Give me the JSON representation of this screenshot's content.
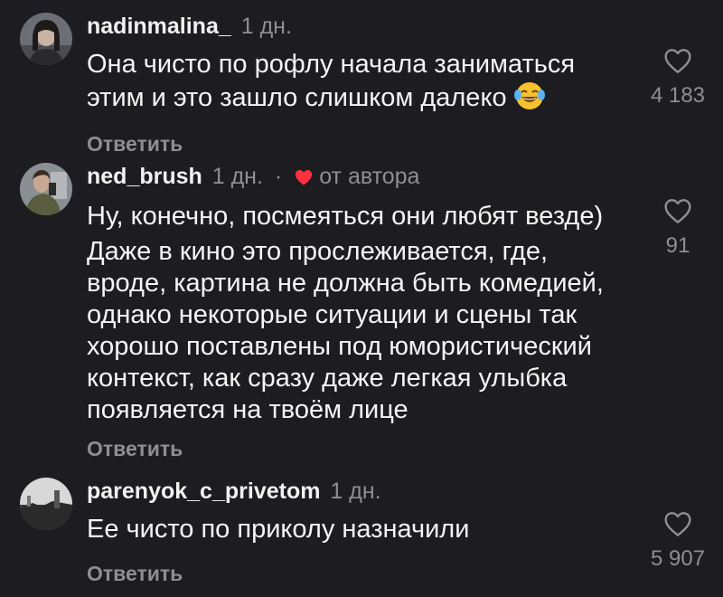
{
  "comments": [
    {
      "username": "nadinmalina_",
      "time": "1 дн.",
      "lines": [
        "Она чисто по рофлу начала заниматься",
        "этим и это зашло слишком далеко"
      ],
      "emoji": "face-with-tears-of-joy",
      "reply_label": "Ответить",
      "likes": "4 183"
    },
    {
      "username": "ned_brush",
      "time": "1 дн.",
      "separator": "·",
      "author_label": "от автора",
      "paragraphs": [
        "Ну, конечно, посмеяться они любят везде)",
        "Даже в кино это прослеживается, где, вроде, картина не должна быть комедией, однако некоторые ситуации и сцены так хорошо поставлены под юмористический контекст, как сразу даже легкая улыбка появляется на твоём лице"
      ],
      "reply_label": "Ответить",
      "likes": "91"
    },
    {
      "username": "parenyok_c_privetom",
      "time": "1 дн.",
      "lines": [
        "Ее чисто по приколу назначили"
      ],
      "reply_label": "Ответить",
      "likes": "5 907"
    }
  ],
  "colors": {
    "background": "#1c1c21",
    "text": "#f2f2f2",
    "secondary": "#8e8e93",
    "author_heart": "#ff3040"
  }
}
